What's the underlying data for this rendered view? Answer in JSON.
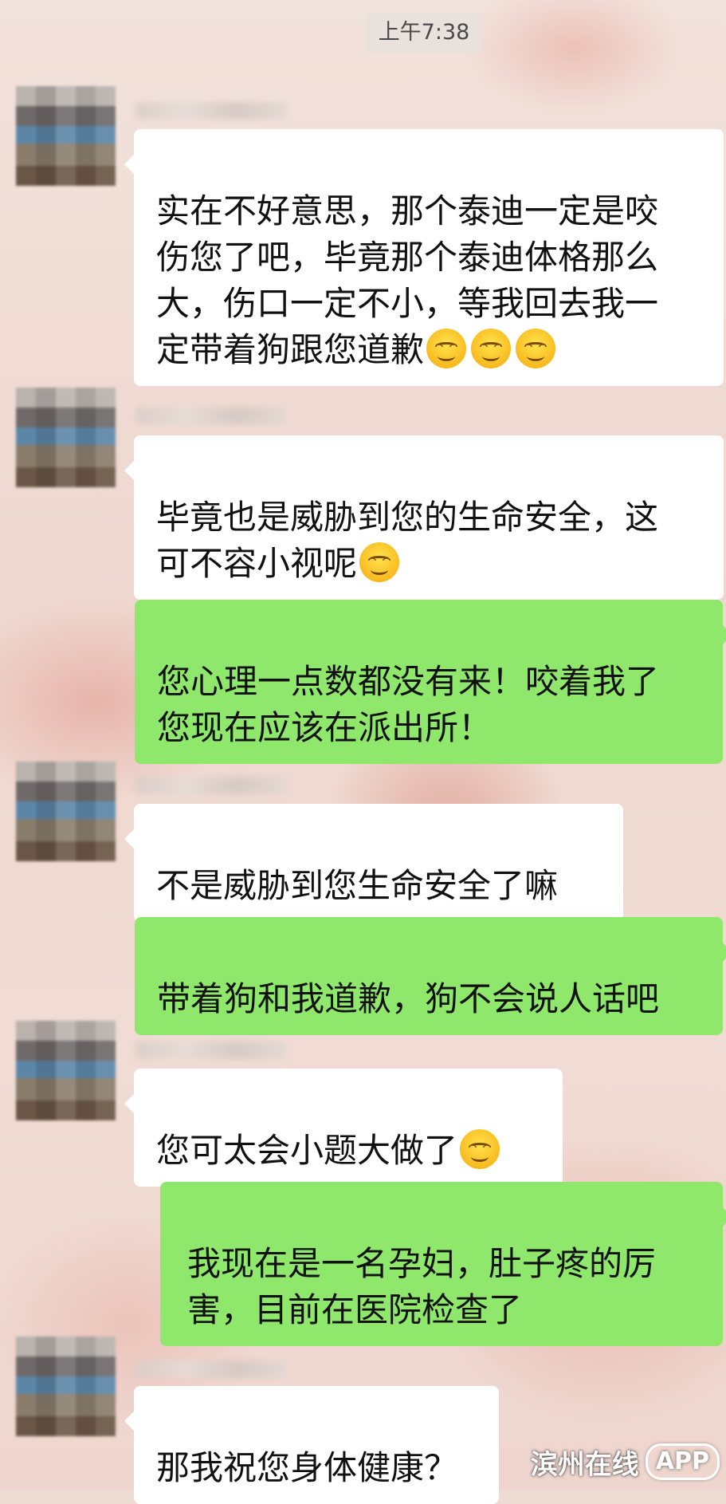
{
  "chat": {
    "timestamp": "上午7:38",
    "messages": [
      {
        "side": "left",
        "text": "实在不好意思，那个泰迪一定是咬\n伤您了吧，毕竟那个泰迪体格那么\n大，伤口一定不小，等我回去我一\n定带着狗跟您道歉",
        "emojis": [
          "smile-emoji",
          "smile-emoji",
          "smile-emoji"
        ]
      },
      {
        "side": "left",
        "text": "毕竟也是威胁到您的生命安全，这\n可不容小视呢",
        "emojis": [
          "smile-emoji"
        ]
      },
      {
        "side": "right",
        "text": "您心理一点数都没有来！咬着我了\n您现在应该在派出所！"
      },
      {
        "side": "left",
        "text": "不是威胁到您生命安全了嘛"
      },
      {
        "side": "right",
        "text": "带着狗和我道歉，狗不会说人话吧"
      },
      {
        "side": "left",
        "text": "您可太会小题大做了",
        "emojis": [
          "smile-emoji"
        ]
      },
      {
        "side": "right",
        "text": "我现在是一名孕妇，肚子疼的厉\n害，目前在医院检查了"
      },
      {
        "side": "left",
        "text": "那我祝您身体健康？"
      }
    ]
  },
  "watermark": {
    "brand": "滨州在线",
    "app": "APP"
  },
  "colors": {
    "outgoing_bubble": "#8fe76b",
    "incoming_bubble": "#ffffff"
  }
}
